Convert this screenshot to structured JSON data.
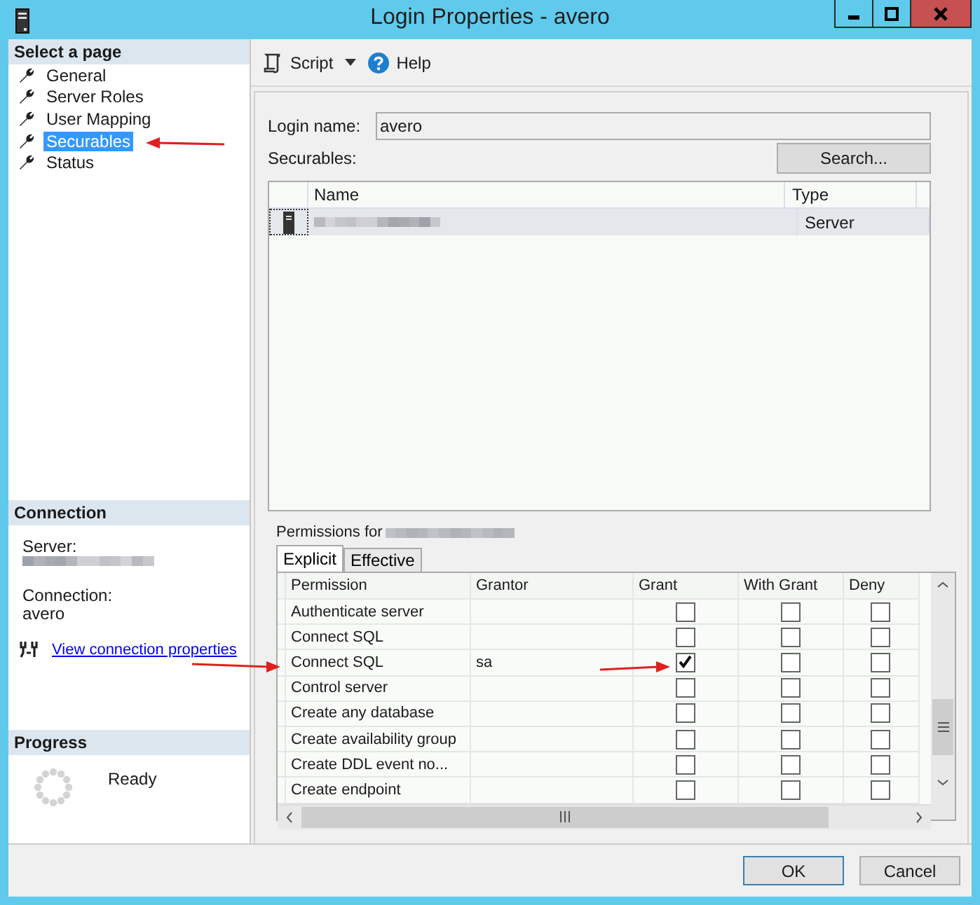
{
  "window": {
    "title": "Login Properties - avero"
  },
  "sidebar": {
    "header": "Select a page",
    "pages": [
      {
        "label": "General",
        "selected": false
      },
      {
        "label": "Server Roles",
        "selected": false
      },
      {
        "label": "User Mapping",
        "selected": false
      },
      {
        "label": "Securables",
        "selected": true
      },
      {
        "label": "Status",
        "selected": false
      }
    ]
  },
  "connection": {
    "header": "Connection",
    "server_label": "Server:",
    "connection_label": "Connection:",
    "connection_value": "avero",
    "link": "View connection properties"
  },
  "progress": {
    "header": "Progress",
    "status": "Ready"
  },
  "toolbar": {
    "script": "Script",
    "help": "Help"
  },
  "login": {
    "label": "Login name:",
    "value": "avero"
  },
  "securables": {
    "label": "Securables:",
    "search_button": "Search...",
    "columns": [
      "Name",
      "Type"
    ],
    "rows": [
      {
        "type": "Server",
        "selected": true
      }
    ]
  },
  "permissions": {
    "label": "Permissions for",
    "tabs": [
      {
        "label": "Explicit",
        "selected": true
      },
      {
        "label": "Effective",
        "selected": false
      }
    ],
    "columns": [
      "Permission",
      "Grantor",
      "Grant",
      "With Grant",
      "Deny"
    ],
    "rows": [
      {
        "permission": "Authenticate server",
        "grantor": "",
        "grant": false,
        "with_grant": false,
        "deny": false
      },
      {
        "permission": "Connect SQL",
        "grantor": "",
        "grant": false,
        "with_grant": false,
        "deny": false
      },
      {
        "permission": "Connect SQL",
        "grantor": "sa",
        "grant": true,
        "with_grant": false,
        "deny": false
      },
      {
        "permission": "Control server",
        "grantor": "",
        "grant": false,
        "with_grant": false,
        "deny": false
      },
      {
        "permission": "Create any database",
        "grantor": "",
        "grant": false,
        "with_grant": false,
        "deny": false
      },
      {
        "permission": "Create availability group",
        "grantor": "",
        "grant": false,
        "with_grant": false,
        "deny": false
      },
      {
        "permission": "Create DDL event no...",
        "grantor": "",
        "grant": false,
        "with_grant": false,
        "deny": false
      },
      {
        "permission": "Create endpoint",
        "grantor": "",
        "grant": false,
        "with_grant": false,
        "deny": false
      }
    ]
  },
  "buttons": [
    "OK",
    "Cancel"
  ]
}
